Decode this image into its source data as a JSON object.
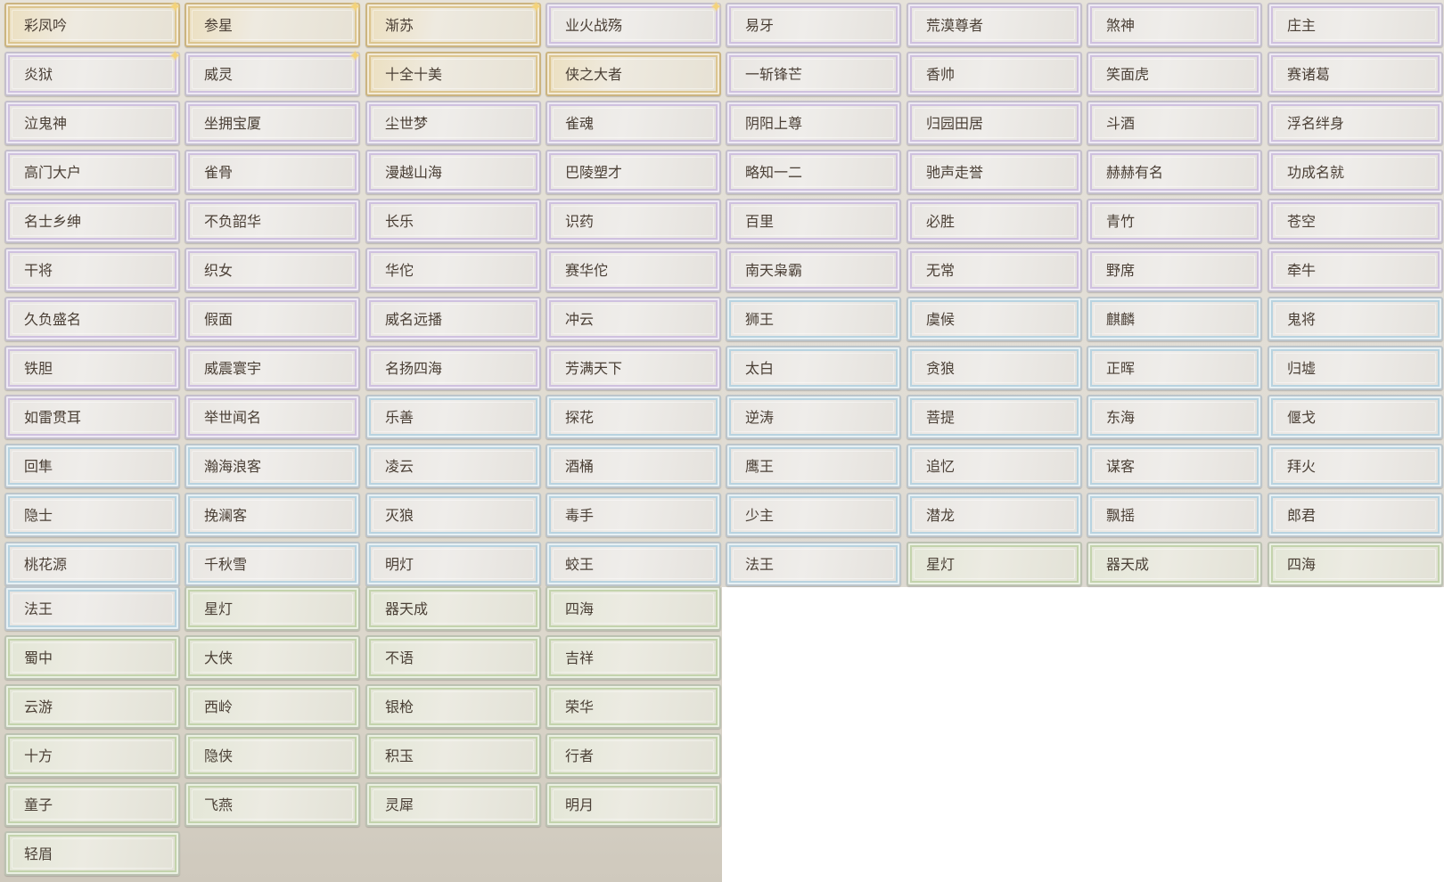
{
  "titles": [
    {
      "label": "彩凤吟",
      "rarity": "gold",
      "sparkle": true
    },
    {
      "label": "参星",
      "rarity": "gold",
      "sparkle": true
    },
    {
      "label": "渐苏",
      "rarity": "gold",
      "sparkle": true
    },
    {
      "label": "业火战殇",
      "rarity": "purple",
      "sparkle": true
    },
    {
      "label": "易牙",
      "rarity": "purple"
    },
    {
      "label": "荒漠尊者",
      "rarity": "purple"
    },
    {
      "label": "煞神",
      "rarity": "purple"
    },
    {
      "label": "庄主",
      "rarity": "purple"
    },
    {
      "label": "炎狱",
      "rarity": "purple",
      "sparkle": true
    },
    {
      "label": "威灵",
      "rarity": "purple",
      "sparkle": true
    },
    {
      "label": "十全十美",
      "rarity": "gold"
    },
    {
      "label": "侠之大者",
      "rarity": "gold"
    },
    {
      "label": "一斩锋芒",
      "rarity": "purple"
    },
    {
      "label": "香帅",
      "rarity": "purple"
    },
    {
      "label": "笑面虎",
      "rarity": "purple"
    },
    {
      "label": "赛诸葛",
      "rarity": "purple"
    },
    {
      "label": "泣鬼神",
      "rarity": "purple"
    },
    {
      "label": "坐拥宝厦",
      "rarity": "purple"
    },
    {
      "label": "尘世梦",
      "rarity": "purple"
    },
    {
      "label": "雀魂",
      "rarity": "purple"
    },
    {
      "label": "阴阳上尊",
      "rarity": "purple"
    },
    {
      "label": "归园田居",
      "rarity": "purple"
    },
    {
      "label": "斗酒",
      "rarity": "purple"
    },
    {
      "label": "浮名绊身",
      "rarity": "purple"
    },
    {
      "label": "高门大户",
      "rarity": "purple"
    },
    {
      "label": "雀骨",
      "rarity": "purple"
    },
    {
      "label": "漫越山海",
      "rarity": "purple"
    },
    {
      "label": "巴陵塑才",
      "rarity": "purple"
    },
    {
      "label": "略知一二",
      "rarity": "purple"
    },
    {
      "label": "驰声走誉",
      "rarity": "purple"
    },
    {
      "label": "赫赫有名",
      "rarity": "purple"
    },
    {
      "label": "功成名就",
      "rarity": "purple"
    },
    {
      "label": "名士乡绅",
      "rarity": "purple"
    },
    {
      "label": "不负韶华",
      "rarity": "purple"
    },
    {
      "label": "长乐",
      "rarity": "purple"
    },
    {
      "label": "识药",
      "rarity": "purple"
    },
    {
      "label": "百里",
      "rarity": "purple"
    },
    {
      "label": "必胜",
      "rarity": "purple"
    },
    {
      "label": "青竹",
      "rarity": "purple"
    },
    {
      "label": "苍空",
      "rarity": "purple"
    },
    {
      "label": "干将",
      "rarity": "purple"
    },
    {
      "label": "织女",
      "rarity": "purple"
    },
    {
      "label": "华佗",
      "rarity": "purple"
    },
    {
      "label": "赛华佗",
      "rarity": "purple"
    },
    {
      "label": "南天枭霸",
      "rarity": "purple"
    },
    {
      "label": "无常",
      "rarity": "purple"
    },
    {
      "label": "野席",
      "rarity": "purple"
    },
    {
      "label": "牵牛",
      "rarity": "purple"
    },
    {
      "label": "久负盛名",
      "rarity": "purple"
    },
    {
      "label": "假面",
      "rarity": "purple"
    },
    {
      "label": "威名远播",
      "rarity": "purple"
    },
    {
      "label": "冲云",
      "rarity": "purple"
    },
    {
      "label": "狮王",
      "rarity": "blue"
    },
    {
      "label": "虞候",
      "rarity": "blue"
    },
    {
      "label": "麒麟",
      "rarity": "blue"
    },
    {
      "label": "鬼将",
      "rarity": "blue"
    },
    {
      "label": "铁胆",
      "rarity": "purple"
    },
    {
      "label": "威震寰宇",
      "rarity": "purple"
    },
    {
      "label": "名扬四海",
      "rarity": "purple"
    },
    {
      "label": "芳满天下",
      "rarity": "purple"
    },
    {
      "label": "太白",
      "rarity": "blue"
    },
    {
      "label": "贪狼",
      "rarity": "blue"
    },
    {
      "label": "正晖",
      "rarity": "blue"
    },
    {
      "label": "归墟",
      "rarity": "blue"
    },
    {
      "label": "如雷贯耳",
      "rarity": "purple"
    },
    {
      "label": "举世闻名",
      "rarity": "purple"
    },
    {
      "label": "乐善",
      "rarity": "blue"
    },
    {
      "label": "探花",
      "rarity": "blue"
    },
    {
      "label": "逆涛",
      "rarity": "blue"
    },
    {
      "label": "菩提",
      "rarity": "blue"
    },
    {
      "label": "东海",
      "rarity": "blue"
    },
    {
      "label": "偃戈",
      "rarity": "blue"
    },
    {
      "label": "回隼",
      "rarity": "blue"
    },
    {
      "label": "瀚海浪客",
      "rarity": "blue"
    },
    {
      "label": "凌云",
      "rarity": "blue"
    },
    {
      "label": "酒桶",
      "rarity": "blue"
    },
    {
      "label": "鹰王",
      "rarity": "blue"
    },
    {
      "label": "追忆",
      "rarity": "blue"
    },
    {
      "label": "谋客",
      "rarity": "blue"
    },
    {
      "label": "拜火",
      "rarity": "blue"
    },
    {
      "label": "隐士",
      "rarity": "blue"
    },
    {
      "label": "挽澜客",
      "rarity": "blue"
    },
    {
      "label": "灭狼",
      "rarity": "blue"
    },
    {
      "label": "毒手",
      "rarity": "blue"
    },
    {
      "label": "少主",
      "rarity": "blue"
    },
    {
      "label": "潜龙",
      "rarity": "blue"
    },
    {
      "label": "飘摇",
      "rarity": "blue"
    },
    {
      "label": "郎君",
      "rarity": "blue"
    },
    {
      "label": "桃花源",
      "rarity": "blue"
    },
    {
      "label": "千秋雪",
      "rarity": "blue"
    },
    {
      "label": "明灯",
      "rarity": "blue"
    },
    {
      "label": "蛟王",
      "rarity": "blue"
    },
    {
      "label": "法王",
      "rarity": "blue"
    },
    {
      "label": "星灯",
      "rarity": "green"
    },
    {
      "label": "器天成",
      "rarity": "green"
    },
    {
      "label": "四海",
      "rarity": "green"
    },
    {
      "label": "法王",
      "rarity": "blue"
    },
    {
      "label": "星灯",
      "rarity": "green"
    },
    {
      "label": "器天成",
      "rarity": "green"
    },
    {
      "label": "四海",
      "rarity": "green"
    },
    {
      "label": "蜀中",
      "rarity": "green"
    },
    {
      "label": "大侠",
      "rarity": "green"
    },
    {
      "label": "不语",
      "rarity": "green"
    },
    {
      "label": "吉祥",
      "rarity": "green"
    },
    {
      "label": "云游",
      "rarity": "green"
    },
    {
      "label": "西岭",
      "rarity": "green"
    },
    {
      "label": "银枪",
      "rarity": "green"
    },
    {
      "label": "荣华",
      "rarity": "green"
    },
    {
      "label": "十方",
      "rarity": "green"
    },
    {
      "label": "隐侠",
      "rarity": "green"
    },
    {
      "label": "积玉",
      "rarity": "green"
    },
    {
      "label": "行者",
      "rarity": "green"
    },
    {
      "label": "童子",
      "rarity": "green"
    },
    {
      "label": "飞燕",
      "rarity": "green"
    },
    {
      "label": "灵犀",
      "rarity": "green"
    },
    {
      "label": "明月",
      "rarity": "green"
    },
    {
      "label": "轻眉",
      "rarity": "green"
    }
  ],
  "colors": {
    "gold": "#dcc58f",
    "purple": "#cfc1df",
    "blue": "#b8d3e0",
    "green": "#c3d3ac",
    "text": "#4a3f35",
    "sparkle": "#f4d37a"
  },
  "icons": {
    "sparkle": "sparkle-icon"
  }
}
